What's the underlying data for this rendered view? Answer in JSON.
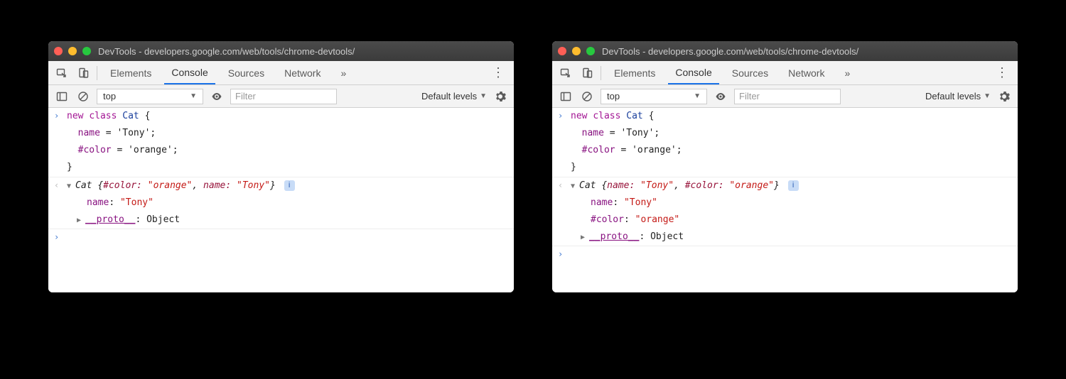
{
  "title": "DevTools - developers.google.com/web/tools/chrome-devtools/",
  "tabs": {
    "elements": "Elements",
    "console": "Console",
    "sources": "Sources",
    "network": "Network"
  },
  "overflow_label": "»",
  "toolbar": {
    "context": "top",
    "filter_placeholder": "Filter",
    "levels_label": "Default levels"
  },
  "code_lines": {
    "l1_kw_new": "new ",
    "l1_kw_class": "class ",
    "l1_classname": "Cat",
    "l1_brace": " {",
    "l2_prop": "name",
    "l2_rest": " = 'Tony';",
    "l3_prop": "#color",
    "l3_rest": " = 'orange';",
    "l4": "}"
  },
  "left": {
    "preview_prefix": "Cat ",
    "preview_key1": "#color: ",
    "preview_val1": "\"orange\"",
    "preview_sep": ", ",
    "preview_key2": "name: ",
    "preview_val2": "\"Tony\"",
    "preview_close": "}",
    "row_name_key": "name",
    "row_name_colon": ": ",
    "row_name_val": "\"Tony\"",
    "proto_key": "__proto__",
    "proto_colon": ": ",
    "proto_val": "Object"
  },
  "right": {
    "preview_prefix": "Cat ",
    "preview_key1": "name: ",
    "preview_val1": "\"Tony\"",
    "preview_sep": ", ",
    "preview_key2": "#color: ",
    "preview_val2": "\"orange\"",
    "preview_close": "}",
    "row_name_key": "name",
    "row_name_colon": ": ",
    "row_name_val": "\"Tony\"",
    "row_color_key": "#color",
    "row_color_colon": ": ",
    "row_color_val": "\"orange\"",
    "proto_key": "__proto__",
    "proto_colon": ": ",
    "proto_val": "Object"
  },
  "info_badge": "i"
}
